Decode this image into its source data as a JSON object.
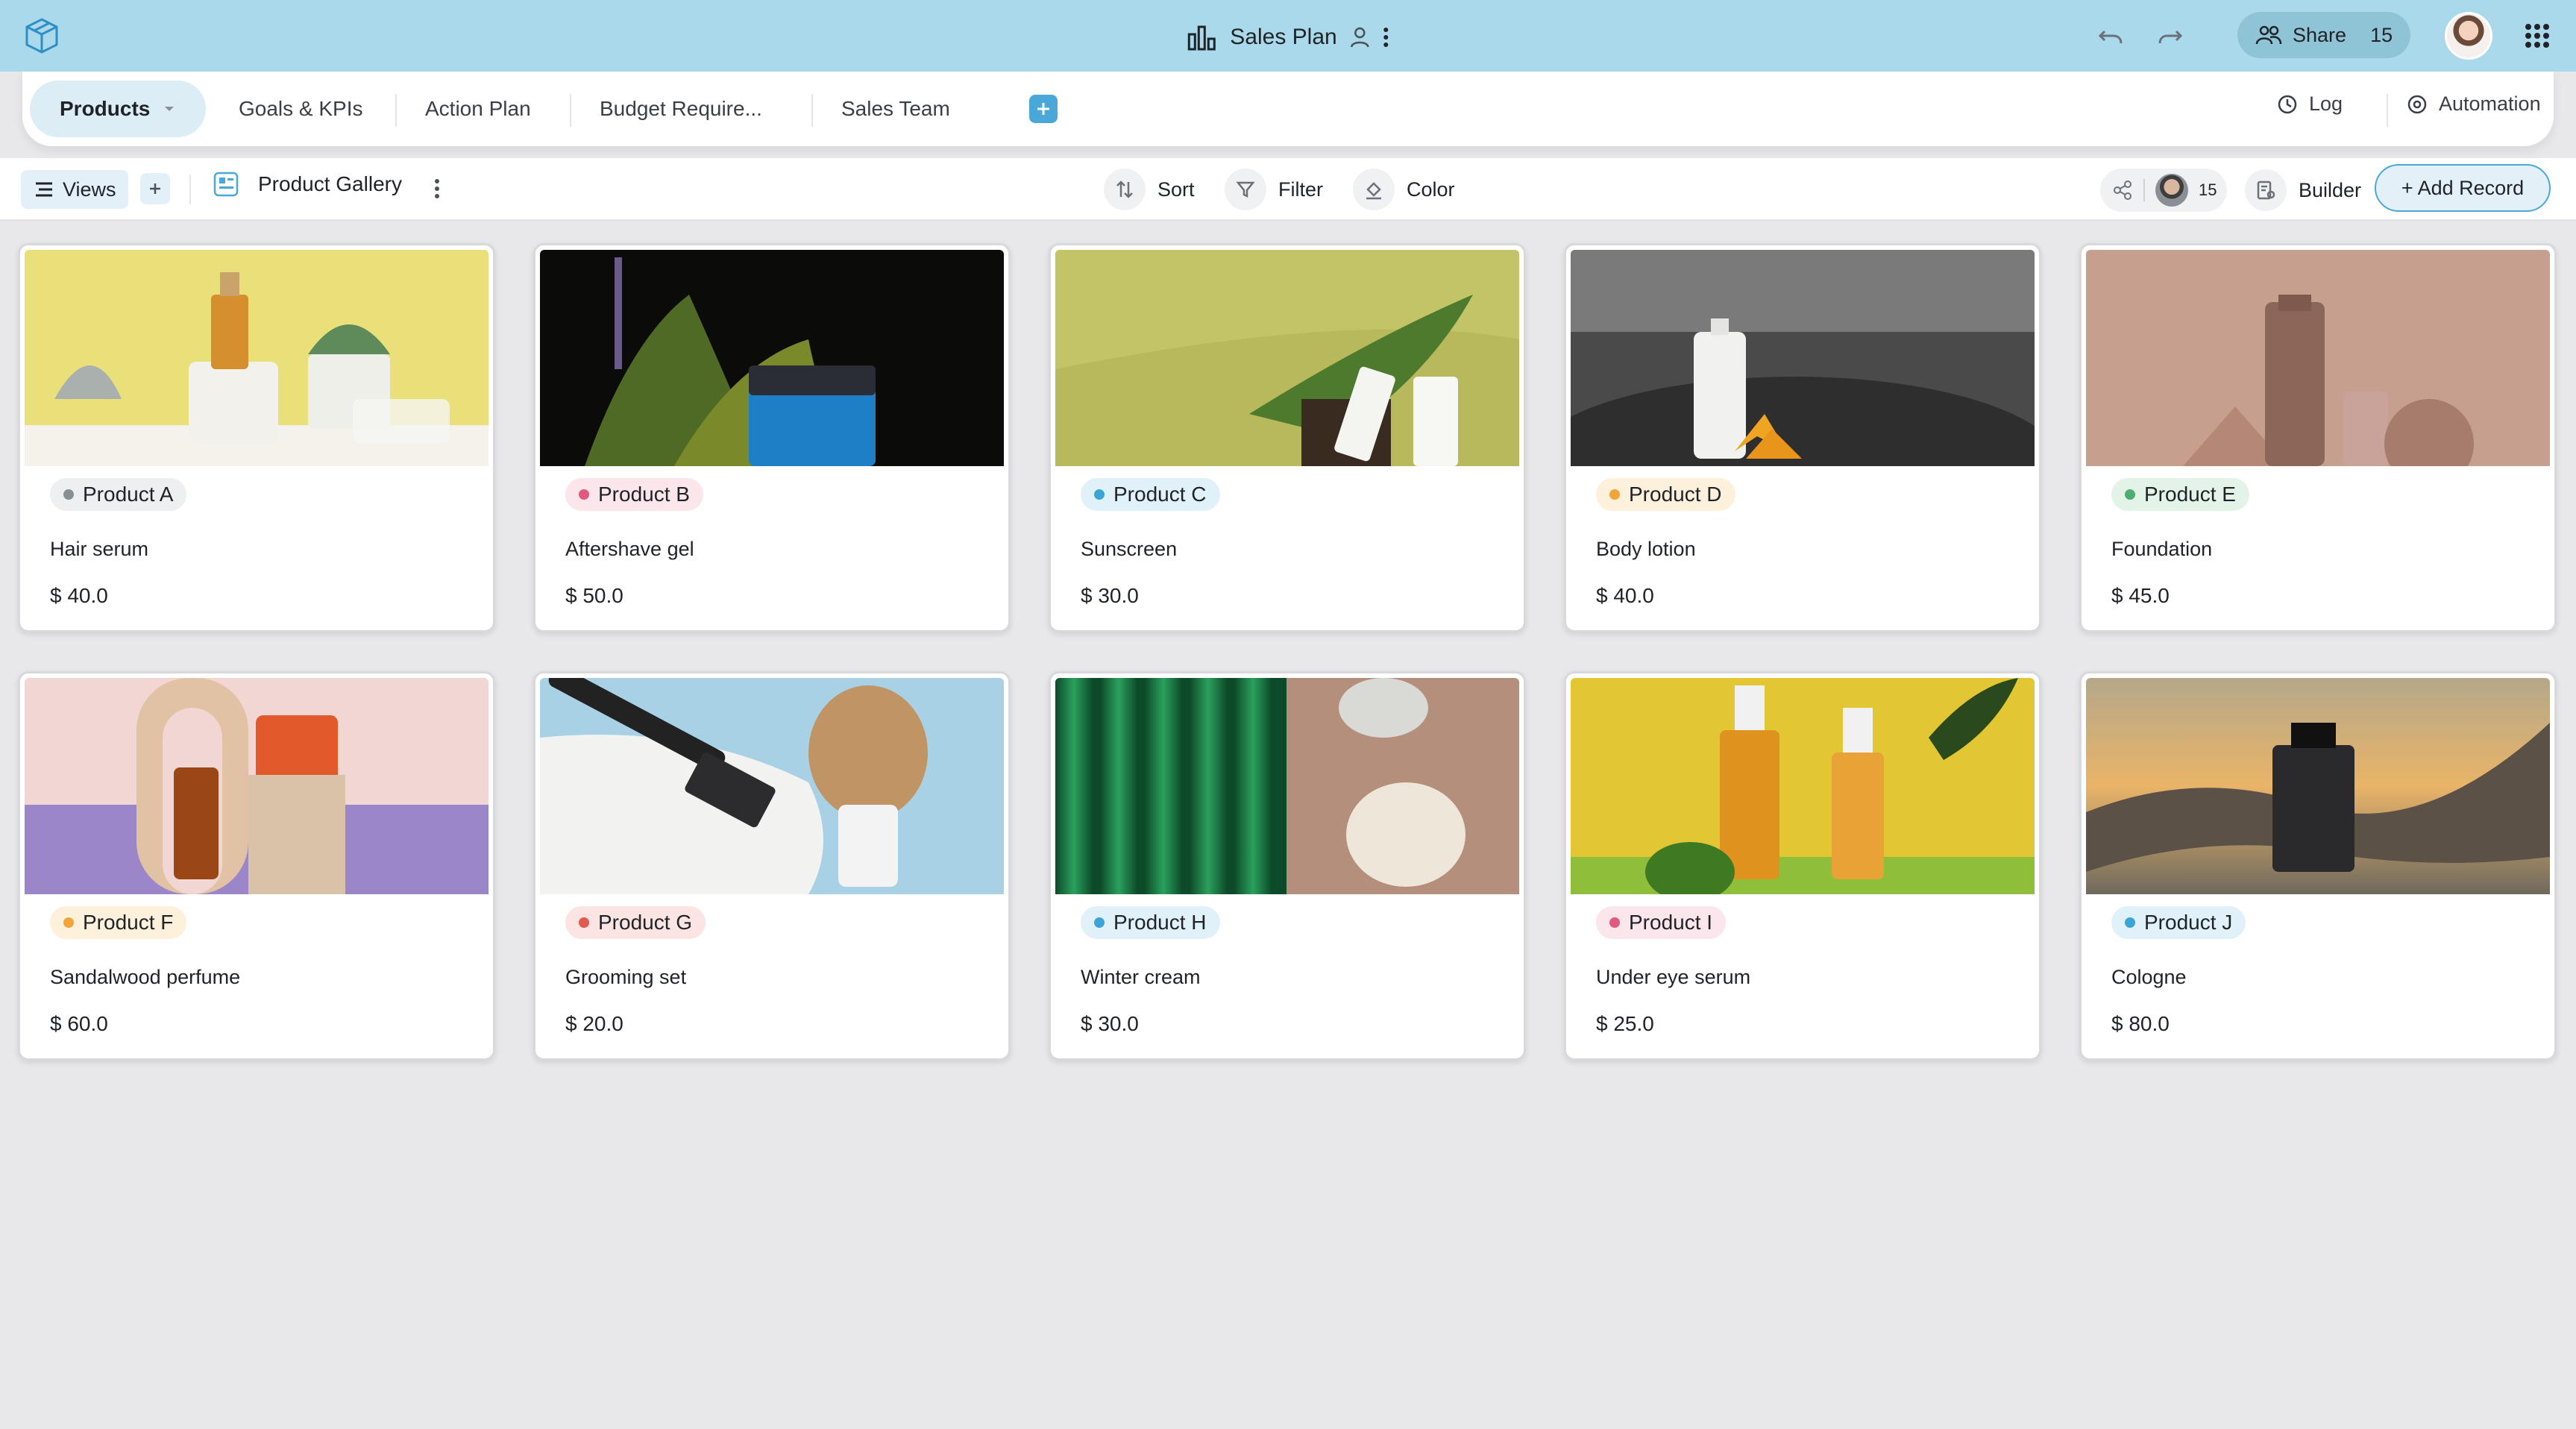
{
  "app": {
    "title": "Sales Plan",
    "share_label": "Share",
    "share_count": "15"
  },
  "tabs": {
    "items": [
      {
        "label": "Products"
      },
      {
        "label": "Goals & KPIs"
      },
      {
        "label": "Action Plan"
      },
      {
        "label": "Budget Require..."
      },
      {
        "label": "Sales Team"
      }
    ],
    "log_label": "Log",
    "automation_label": "Automation"
  },
  "toolbar": {
    "views_label": "Views",
    "view_name": "Product Gallery",
    "sort_label": "Sort",
    "filter_label": "Filter",
    "color_label": "Color",
    "collaborator_count": "15",
    "builder_label": "Builder",
    "add_record_label": "+ Add Record"
  },
  "cards": [
    {
      "tag": "Product A",
      "name": "Hair serum",
      "price": "$ 40.0",
      "tag_color": "#8a8f96",
      "tag_bg": "#eeeff1"
    },
    {
      "tag": "Product B",
      "name": "Aftershave gel",
      "price": "$ 50.0",
      "tag_color": "#e1597f",
      "tag_bg": "#fbe6ec"
    },
    {
      "tag": "Product C",
      "name": "Sunscreen",
      "price": "$ 30.0",
      "tag_color": "#3ba5d6",
      "tag_bg": "#e1f1f9"
    },
    {
      "tag": "Product D",
      "name": "Body lotion",
      "price": "$ 40.0",
      "tag_color": "#f0a53a",
      "tag_bg": "#fdf1dc"
    },
    {
      "tag": "Product E",
      "name": "Foundation",
      "price": "$ 45.0",
      "tag_color": "#4caf6e",
      "tag_bg": "#e3f3e8"
    },
    {
      "tag": "Product F",
      "name": "Sandalwood perfume",
      "price": "$ 60.0",
      "tag_color": "#f0a53a",
      "tag_bg": "#fdf1dc"
    },
    {
      "tag": "Product G",
      "name": "Grooming set",
      "price": "$ 20.0",
      "tag_color": "#e05a4e",
      "tag_bg": "#fbe4e1"
    },
    {
      "tag": "Product H",
      "name": "Winter cream",
      "price": "$ 30.0",
      "tag_color": "#3ba5d6",
      "tag_bg": "#e1f1f9"
    },
    {
      "tag": "Product I",
      "name": "Under eye serum",
      "price": "$ 25.0",
      "tag_color": "#e1597f",
      "tag_bg": "#fbe6ec"
    },
    {
      "tag": "Product J",
      "name": "Cologne",
      "price": "$ 80.0",
      "tag_color": "#3ba5d6",
      "tag_bg": "#e1f1f9"
    }
  ],
  "colors": {
    "topbar": "#a9d9ea",
    "accent": "#4aa8d8",
    "active_tab_bg": "#dcedf6",
    "canvas": "#e8e8ea"
  }
}
